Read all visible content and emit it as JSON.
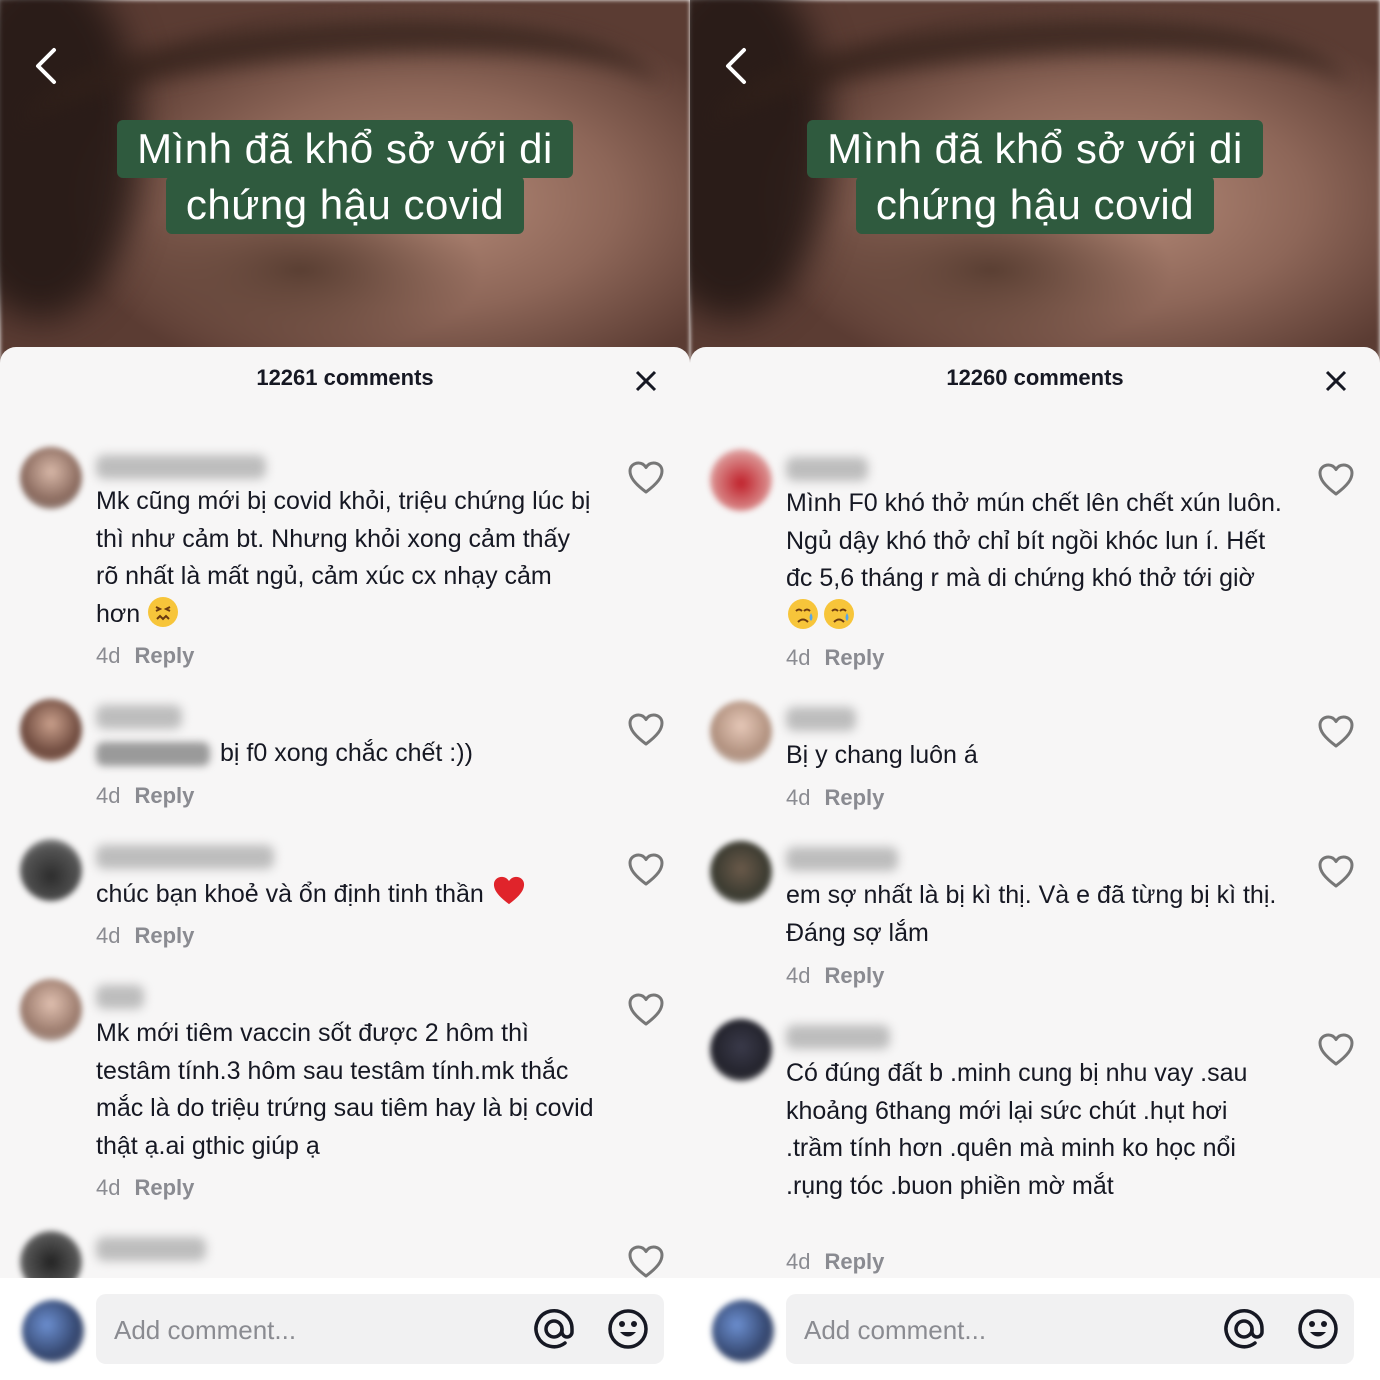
{
  "panels": [
    {
      "caption": {
        "line1": "Mình đã khổ sở với di",
        "line2": "chứng hậu covid"
      },
      "comments_count": "12261 comments",
      "comments": [
        {
          "text": "Mk cũng mới bị covid khỏi, triệu chứng lúc bị thì như cảm bt. Nhưng khỏi xong cảm thấy rõ nhất là mất ngủ, cảm xúc cx nhạy cảm hơn",
          "emoji": [
            "confounded-face-icon"
          ],
          "time": "4d",
          "reply": "Reply"
        },
        {
          "mention": "@",
          "text": "bị f0 xong chắc chết :))",
          "time": "4d",
          "reply": "Reply"
        },
        {
          "text": "chúc bạn khoẻ và ổn định tinh thần",
          "emoji": [
            "red-heart-icon"
          ],
          "time": "4d",
          "reply": "Reply"
        },
        {
          "text": "Mk mới tiêm vaccin sốt được 2 hôm thì testâm tính.3 hôm sau testâm tính.mk thắc mắc là do triệu trứng sau tiêm hay là bị covid thật ạ.ai gthic giúp ạ",
          "time": "4d",
          "reply": "Reply"
        }
      ],
      "input_placeholder": "Add comment..."
    },
    {
      "caption": {
        "line1": "Mình đã khổ sở với di",
        "line2": "chứng hậu covid"
      },
      "comments_count": "12260 comments",
      "comments": [
        {
          "text": "Mình F0 khó thở mún chết lên chết xún luôn. Ngủ dậy khó thở chỉ bít ngồi khóc lun í. Hết đc 5,6 tháng r mà di chứng khó thở tới giờ",
          "emoji": [
            "crying-face-icon",
            "crying-face-icon"
          ],
          "time": "4d",
          "reply": "Reply"
        },
        {
          "text": "Bị y chang luôn á",
          "time": "4d",
          "reply": "Reply"
        },
        {
          "text": "em sợ nhất là bị kì thị. Và e đã từng bị kì thị. Đáng sợ lắm",
          "time": "4d",
          "reply": "Reply"
        },
        {
          "text": "Có đúng đất b .minh cung bị nhu vay .sau khoảng 6thang mới lại sức chút .hụt hơi .trầm tính hơn .quên mà minh ko học nổi .rụng tóc .buon phiền mờ mắt",
          "time": "4d",
          "reply": "Reply"
        }
      ],
      "input_placeholder": "Add comment..."
    }
  ],
  "colors": {
    "caption_bg": "#2f5a3e",
    "sheet_bg": "#f7f6f6",
    "text": "#161823",
    "meta": "#8a8b91"
  }
}
